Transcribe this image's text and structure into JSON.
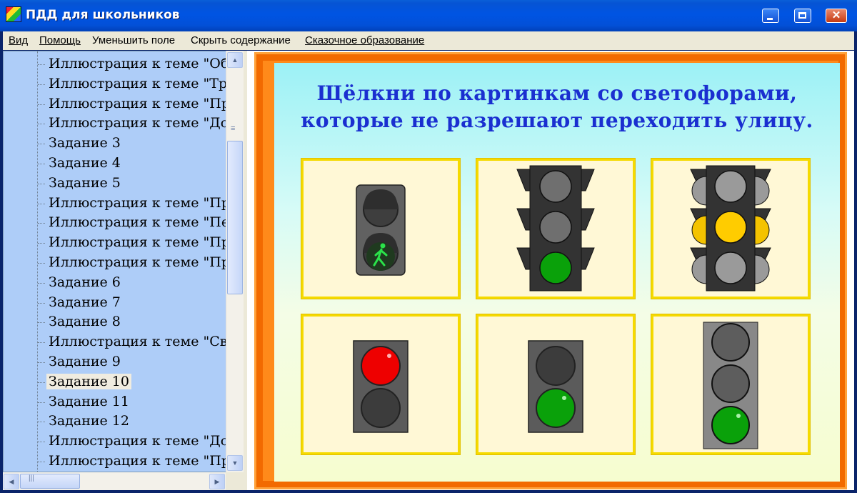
{
  "window": {
    "title": "ПДД для школьников",
    "buttons": {
      "minimize": "minimize",
      "maximize": "maximize",
      "close": "✕"
    }
  },
  "menu": [
    {
      "label": "Вид",
      "underline": true
    },
    {
      "label": "Помощь",
      "underline": true
    },
    {
      "label": "Уменьшить поле",
      "underline": false
    },
    {
      "label": "Скрыть содержание",
      "underline": false
    },
    {
      "label": "Сказочное образование",
      "underline": true
    }
  ],
  "tree": {
    "items": [
      "Иллюстрация к теме \"Общ",
      "Иллюстрация к теме \"Тран",
      "Иллюстрация к теме \"Прав",
      "Иллюстрация к теме \"Доро",
      "Задание 3",
      "Задание 4",
      "Задание 5",
      "Иллюстрация к теме \"Прав",
      "Иллюстрация к теме \"Пеш",
      "Иллюстрация к теме \"Прав",
      "Иллюстрация к теме \"Прав",
      "Задание 6",
      "Задание 7",
      "Задание 8",
      "Иллюстрация к теме \"Свет",
      "Задание 9",
      "Задание 10",
      "Задание 11",
      "Задание 12",
      "Иллюстрация к теме \"Доро",
      "Иллюстрация к теме \"Пред"
    ],
    "selected_index": 16
  },
  "content": {
    "heading_line1": "Щёлкни по картинкам со светофорами,",
    "heading_line2": "которые не разрешают переходить улицу.",
    "cards": [
      {
        "kind": "pedestrian",
        "lights": [
          "off",
          "green-walk"
        ]
      },
      {
        "kind": "car-3",
        "lights": [
          "off",
          "off",
          "green"
        ]
      },
      {
        "kind": "car-3",
        "lights": [
          "off",
          "yellow",
          "off"
        ]
      },
      {
        "kind": "pedestrian-2",
        "lights": [
          "red",
          "off"
        ]
      },
      {
        "kind": "pedestrian-2",
        "lights": [
          "off",
          "green"
        ]
      },
      {
        "kind": "vertical-3",
        "lights": [
          "off",
          "off",
          "green"
        ]
      }
    ]
  },
  "colors": {
    "heading": "#1a2fd0",
    "card_border": "#f5da00",
    "frame": "#ff8a1a",
    "tree_bg": "#aecdf8"
  }
}
